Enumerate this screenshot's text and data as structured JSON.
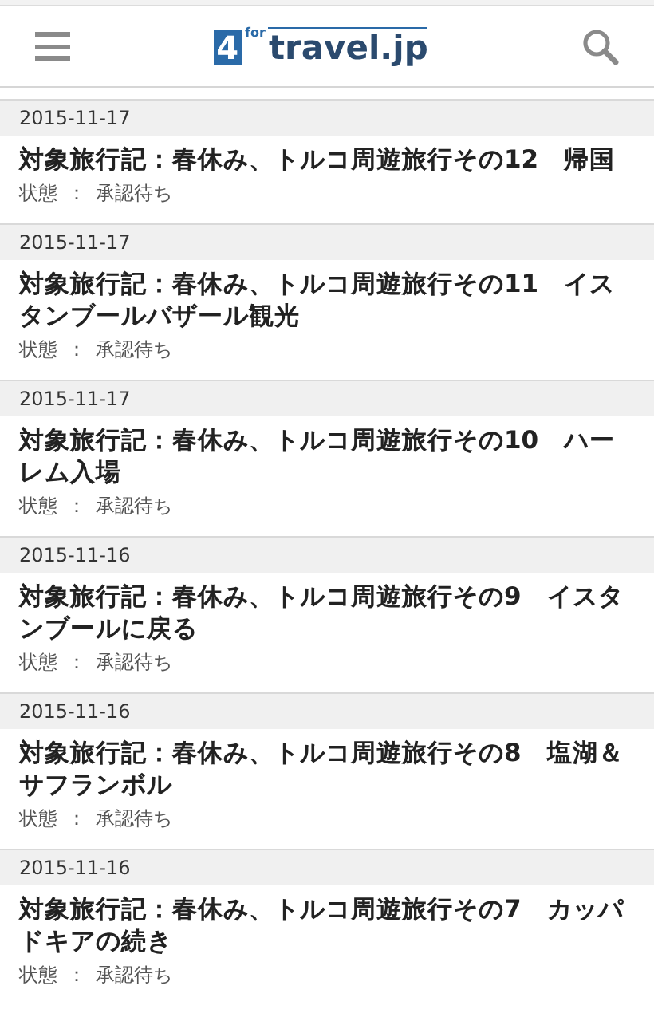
{
  "header": {
    "logo": {
      "mark": "4",
      "sub": "for",
      "text": "travel.jp"
    }
  },
  "entries": [
    {
      "date": "2015-11-17",
      "title": "対象旅行記：春休み、トルコ周遊旅行その12　帰国",
      "status_label": "状態",
      "separator": "：",
      "status": "承認待ち"
    },
    {
      "date": "2015-11-17",
      "title": "対象旅行記：春休み、トルコ周遊旅行その11　イスタンブールバザール観光",
      "status_label": "状態",
      "separator": "：",
      "status": "承認待ち"
    },
    {
      "date": "2015-11-17",
      "title": "対象旅行記：春休み、トルコ周遊旅行その10　ハーレム入場",
      "status_label": "状態",
      "separator": "：",
      "status": "承認待ち"
    },
    {
      "date": "2015-11-16",
      "title": "対象旅行記：春休み、トルコ周遊旅行その9　イスタンブールに戻る",
      "status_label": "状態",
      "separator": "：",
      "status": "承認待ち"
    },
    {
      "date": "2015-11-16",
      "title": "対象旅行記：春休み、トルコ周遊旅行その8　塩湖＆サフランボル",
      "status_label": "状態",
      "separator": "：",
      "status": "承認待ち"
    },
    {
      "date": "2015-11-16",
      "title": "対象旅行記：春休み、トルコ周遊旅行その7　カッパドキアの続き",
      "status_label": "状態",
      "separator": "：",
      "status": "承認待ち"
    }
  ]
}
